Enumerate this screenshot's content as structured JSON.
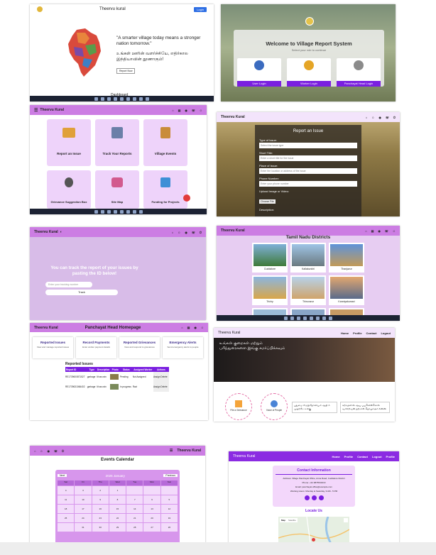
{
  "s1": {
    "brand": "Theervu kural",
    "login": "Login",
    "quote": "\"A smarter village today means a stronger nation tomorrow.\"",
    "tamil": "உங்கள் ஊரின் வளர்ச்சியே, எதிர்கால இந்தியாவின் தூணாகும்!",
    "cta": "Report Now",
    "dashboard": "Dashboard"
  },
  "s2": {
    "title": "Welcome to Village Report System",
    "subtitle": "Select your role to continue",
    "roles": [
      "User Login",
      "Worker Login",
      "Panchayat Head Login"
    ]
  },
  "s3": {
    "brand": "Theervu Kural",
    "cards": [
      "Report an Issue",
      "Track Your Reports",
      "Village Events",
      "Grievance Suggestion Box",
      "Site Map",
      "Funding for Projects"
    ]
  },
  "s4": {
    "brand": "Theervu Kural",
    "form_title": "Report an Issue",
    "fields": [
      {
        "label": "Type of Issue:",
        "placeholder": "Select the issue type"
      },
      {
        "label": "Short Title:",
        "placeholder": "Enter a short title for the issue"
      },
      {
        "label": "Place of Issue:",
        "placeholder": "Enter the location or address of the issue"
      },
      {
        "label": "Phone Number:",
        "placeholder": "Enter your phone number"
      }
    ],
    "upload_label": "Upload Image or Video:",
    "upload_btn": "Choose File",
    "more": "Description:"
  },
  "s5": {
    "brand": "Theervu Kural",
    "heading": "You can track the report of your issues by pasting the ID below!",
    "input_placeholder": "Enter your tracking number",
    "button": "Track"
  },
  "s6": {
    "brand": "Theervu Kural",
    "title": "Tamil Nadu Districts",
    "districts": [
      "Cuddalore",
      "Kallakurichi",
      "Thanjavur",
      "Trichy",
      "Thiruvarur",
      "Kanniyakumari"
    ]
  },
  "s7": {
    "brand": "Theervu Kural",
    "title": "Panchayat Head Homepage",
    "cards": [
      {
        "title": "Reported Issues",
        "desc": "View and manage reported issues"
      },
      {
        "title": "Record Payments",
        "desc": "Enter worker payment details"
      },
      {
        "title": "Reported Grievances",
        "desc": "View and respond to grievances"
      },
      {
        "title": "Emergency Alerts",
        "desc": "Send emergency alerts to people"
      }
    ],
    "table_title": "Reported Issues",
    "columns": [
      "Report ID",
      "Type",
      "Description",
      "Photo",
      "Status",
      "Assigned Worker",
      "Actions"
    ],
    "rows": [
      [
        "RE1739600871527",
        "garbage",
        "It has rain",
        "",
        "Pending",
        "Not Assigned",
        "Assign  Delete"
      ],
      [
        "RE1739631066402",
        "garbage",
        "It has rain",
        "",
        "In progress",
        "Ravi",
        "Assign  Delete"
      ]
    ]
  },
  "s8": {
    "brand": "Theervu Kural",
    "nav": [
      "Home",
      "Profile",
      "Contact",
      "Logout"
    ],
    "hero": "உங்கள் குறைகள் மற்றும் பரிந்துரைகளை இங்கு சமர்ப்பிக்கவும்",
    "circles": [
      "File a Grievance",
      "Voice of People"
    ],
    "notes": [
      "புதுமை எழுத்தோவியம் ஆதி ஈ முதற்றே உலகு",
      "கற்றதனால் ஆய பயனென்கொல் வாலறிவன் நற்றாள் தொழாஅர் எனின்"
    ]
  },
  "s9": {
    "brand": "Theervu Kural",
    "title": "Events Calendar",
    "month": "2025 January",
    "prev": "Previous",
    "next": "Next",
    "days": [
      "Sun",
      "Mon",
      "Tue",
      "Wed",
      "Thu",
      "Fri",
      "Sat"
    ],
    "dates": [
      "",
      "",
      "",
      "1",
      "2",
      "3",
      "4",
      "5",
      "6",
      "7",
      "8",
      "9",
      "10",
      "11",
      "12",
      "13",
      "14",
      "15",
      "16",
      "17",
      "18",
      "19",
      "20",
      "21",
      "22",
      "23",
      "24",
      "25",
      "26",
      "27",
      "28",
      "29",
      "30",
      "31",
      ""
    ]
  },
  "s10": {
    "brand": "Theervu Kural",
    "nav": [
      "Home",
      "Profile",
      "Contact",
      "Logout",
      "Profile"
    ],
    "contact_title": "Contact Information",
    "address": "Address: Village Panchayat Office, Anna Road, Cuddalore District",
    "phone": "Phone: +91 9876543210",
    "email": "Email: panchayat.office@example.com",
    "hours": "Working Hours: Monday to Saturday, 9 AM - 5 PM",
    "locate": "Locate Us",
    "map_tabs": [
      "Map",
      "Satellite"
    ]
  },
  "colors": {
    "accent": "#cc7de3",
    "deep": "#8b2be2",
    "panel": "#eed3fa"
  }
}
